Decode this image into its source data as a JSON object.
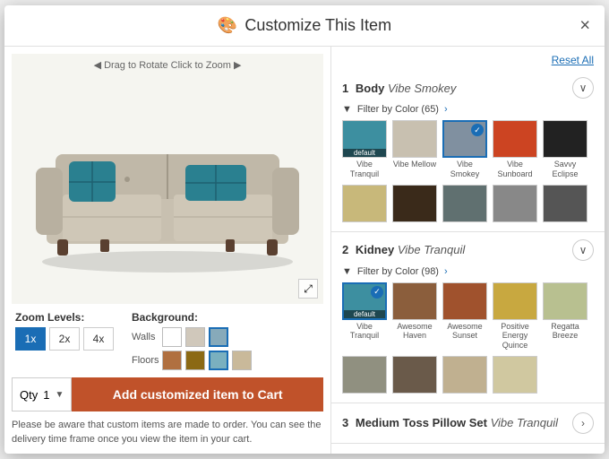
{
  "modal": {
    "title": "Customize This Item",
    "close_label": "×"
  },
  "toolbar": {
    "reset_label": "Reset All"
  },
  "product": {
    "rotate_hint": "◀ Drag to Rotate  Click to Zoom ▶",
    "expand_icon": "⤢"
  },
  "zoom": {
    "label": "Zoom Levels:",
    "options": [
      "1x",
      "2x",
      "4x"
    ],
    "active": 0
  },
  "background": {
    "label": "Background:",
    "walls_label": "Walls",
    "floors_label": "Floors",
    "walls_swatches": [
      {
        "color": "#ffffff",
        "selected": false
      },
      {
        "color": "#d0c8bb",
        "selected": false
      },
      {
        "color": "#87aaba",
        "selected": true
      }
    ],
    "floors_swatches": [
      {
        "color": "#b07040",
        "selected": false
      },
      {
        "color": "#8b6914",
        "selected": false
      },
      {
        "color": "#7ab0bf",
        "selected": true
      },
      {
        "color": "#c9b99a",
        "selected": false
      }
    ]
  },
  "add_to_cart": {
    "qty_label": "Qty",
    "qty_value": "1",
    "btn_label": "Add customized item to Cart"
  },
  "disclaimer": "Please be aware that custom items are made to order. You can see the delivery time frame once you view the item in your cart.",
  "sections": [
    {
      "id": "body",
      "num": "1",
      "part": "Body",
      "value": "Vibe Smokey",
      "filter_label": "Filter by Color (65)",
      "expanded": true,
      "swatches": [
        {
          "name": "Vibe Tranquil",
          "color": "#3d8fa0",
          "default": true,
          "selected": false
        },
        {
          "name": "Vibe Mellow",
          "color": "#c8c0b0",
          "default": false,
          "selected": false
        },
        {
          "name": "Vibe Smokey",
          "color": "#8090a0",
          "default": false,
          "selected": true
        },
        {
          "name": "Vibe Sunboard",
          "color": "#cc4422",
          "default": false,
          "selected": false
        },
        {
          "name": "Savvy Eclipse",
          "color": "#222222",
          "default": false,
          "selected": false
        },
        {
          "name": "",
          "color": "#c8b87a",
          "default": false,
          "selected": false
        },
        {
          "name": "",
          "color": "#3a2a1a",
          "default": false,
          "selected": false
        },
        {
          "name": "",
          "color": "#607070",
          "default": false,
          "selected": false
        },
        {
          "name": "",
          "color": "#888888",
          "default": false,
          "selected": false
        },
        {
          "name": "",
          "color": "#555555",
          "default": false,
          "selected": false
        }
      ]
    },
    {
      "id": "kidney",
      "num": "2",
      "part": "Kidney",
      "value": "Vibe Tranquil",
      "filter_label": "Filter by Color (98)",
      "expanded": true,
      "swatches": [
        {
          "name": "Vibe Tranquil",
          "color": "#3d8fa0",
          "default": true,
          "selected": true
        },
        {
          "name": "Awesome Haven",
          "color": "#8b5e3c",
          "default": false,
          "selected": false
        },
        {
          "name": "Awesome Sunset",
          "color": "#a0522d",
          "default": false,
          "selected": false
        },
        {
          "name": "Positive Energy Quince",
          "color": "#c8a840",
          "default": false,
          "selected": false
        },
        {
          "name": "Regatta Breeze",
          "color": "#b8c090",
          "default": false,
          "selected": false
        },
        {
          "name": "",
          "color": "#909080",
          "default": false,
          "selected": false
        },
        {
          "name": "",
          "color": "#6a5a4a",
          "default": false,
          "selected": false
        },
        {
          "name": "",
          "color": "#c0b090",
          "default": false,
          "selected": false
        },
        {
          "name": "",
          "color": "#d0c8a0",
          "default": false,
          "selected": false
        }
      ]
    },
    {
      "id": "medium-toss-pillow",
      "num": "3",
      "part": "Medium Toss Pillow Set",
      "value": "Vibe Tranquil",
      "expanded": false
    }
  ]
}
